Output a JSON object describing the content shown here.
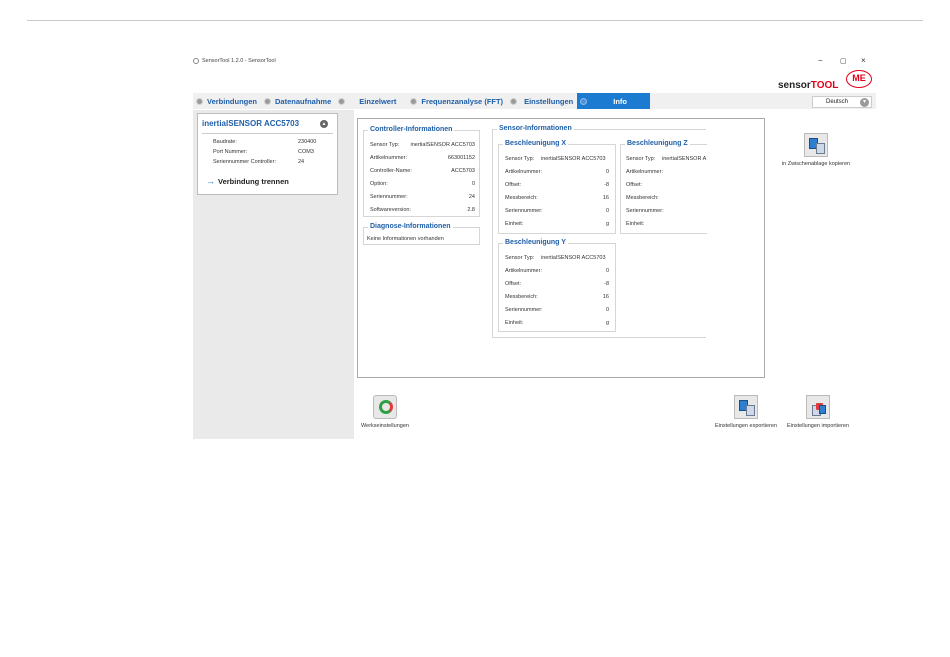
{
  "window": {
    "title": "SensorTool 1.2.0 - SensorTool",
    "minimize": "−",
    "maximize": "▢",
    "close": "×"
  },
  "brand": {
    "name_a": "sensor",
    "name_b": "TOOL",
    "logo": "ME"
  },
  "tabs": [
    {
      "label": "Verbindungen"
    },
    {
      "label": "Datenaufnahme"
    },
    {
      "label": "Einzelwert"
    },
    {
      "label": "Frequenzanalyse (FFT)"
    },
    {
      "label": "Einstellungen"
    },
    {
      "label": "Info",
      "active": true
    }
  ],
  "language": {
    "selected": "Deutsch"
  },
  "device": {
    "title": "inertialSENSOR ACC5703",
    "rows": [
      {
        "label": "Baudrate:",
        "value": "230400"
      },
      {
        "label": "Port Nummer:",
        "value": "COM3"
      },
      {
        "label": "Seriennummer Controller:",
        "value": "24"
      }
    ],
    "disconnect": "Verbindung trennen"
  },
  "controller": {
    "title": "Controller-Informationen",
    "rows": [
      {
        "label": "Sensor Typ:",
        "value": "inertialSENSOR ACC5703"
      },
      {
        "label": "Artikelnummer:",
        "value": "663001152"
      },
      {
        "label": "Controller-Name:",
        "value": "ACC5703"
      },
      {
        "label": "Option:",
        "value": "0"
      },
      {
        "label": "Seriennummer:",
        "value": "24"
      },
      {
        "label": "Softwareversion:",
        "value": "2.8"
      }
    ]
  },
  "diagnose": {
    "title": "Diagnose-Informationen",
    "text": "Keine Informationen vorhanden"
  },
  "sensor": {
    "title": "Sensor-Informationen",
    "x": {
      "title": "Beschleunigung X",
      "rows": [
        {
          "label": "Sensor Typ:",
          "value": "inertialSENSOR ACC5703"
        },
        {
          "label": "Artikelnummer:",
          "value": "0"
        },
        {
          "label": "Offset:",
          "value": "-8"
        },
        {
          "label": "Messbereich:",
          "value": "16"
        },
        {
          "label": "Seriennummer:",
          "value": "0"
        },
        {
          "label": "Einheit:",
          "value": "g"
        }
      ]
    },
    "y": {
      "title": "Beschleunigung Y",
      "rows": [
        {
          "label": "Sensor Typ:",
          "value": "inertialSENSOR ACC5703"
        },
        {
          "label": "Artikelnummer:",
          "value": "0"
        },
        {
          "label": "Offset:",
          "value": "-8"
        },
        {
          "label": "Messbereich:",
          "value": "16"
        },
        {
          "label": "Seriennummer:",
          "value": "0"
        },
        {
          "label": "Einheit:",
          "value": "g"
        }
      ]
    },
    "z": {
      "title": "Beschleunigung Z",
      "rows": [
        {
          "label": "Sensor Typ:",
          "value": "inertialSENSOR A"
        },
        {
          "label": "Artikelnummer:",
          "value": ""
        },
        {
          "label": "Offset:",
          "value": ""
        },
        {
          "label": "Messbereich:",
          "value": ""
        },
        {
          "label": "Seriennummer:",
          "value": ""
        },
        {
          "label": "Einheit:",
          "value": ""
        }
      ]
    }
  },
  "buttons": {
    "clipboard": "in Zwischenablage kopieren",
    "factory": "Werkseinstellungen",
    "export": "Einstellungen exportieren",
    "import": "Einstellungen importieren"
  }
}
